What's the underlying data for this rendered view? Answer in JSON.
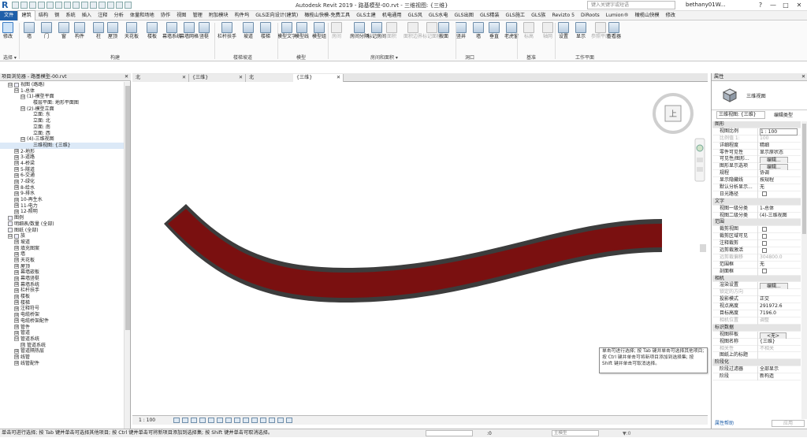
{
  "titlebar": {
    "logo": "R",
    "title": "Autodesk Revit 2019 -   路基模型-00.rvt - 三维视图: {三维}",
    "search_placeholder": "键入关键字或短语",
    "user": "bethany01W...",
    "help": "?",
    "minimize": "—",
    "maximize": "□",
    "close": "✕"
  },
  "menu": {
    "items": [
      "文件",
      "建筑",
      "结构",
      "钢",
      "系统",
      "插入",
      "注释",
      "分析",
      "体量和场地",
      "协作",
      "视图",
      "管理",
      "附加模块",
      "构件坞",
      "GLS正向设计(建筑)",
      "橄榄山快模-免费工具",
      "GLS土建",
      "机电通用",
      "GLS风",
      "GLS水电",
      "GLS出图",
      "GLS精装",
      "GLS施工",
      "GLS族",
      "Revizto 5",
      "DiRoots",
      "Lumion®",
      "橄榄山快模",
      "修改"
    ]
  },
  "ribbon": {
    "tools": [
      "修改",
      "墙",
      "门",
      "窗",
      "构件",
      "柱",
      "屋顶",
      "天花板",
      "楼板",
      "幕墙系统",
      "幕墙网格",
      "竖梃",
      "栏杆扶手",
      "坡道",
      "楼梯",
      "模型文字",
      "模型线",
      "模型组",
      "房间",
      "房间分隔",
      "标记房间",
      "面积",
      "面积边界",
      "标记面积",
      "按面",
      "竖井",
      "墙",
      "垂直",
      "老虎窗",
      "标高",
      "轴网",
      "设置",
      "显示",
      "参照平面",
      "查看器"
    ],
    "panels": [
      "选择 ▾",
      "构建",
      "楼梯坡道",
      "模型",
      "房间和面积 ▾",
      "洞口",
      "基准",
      "工作平面"
    ]
  },
  "project_browser": {
    "title": "项目浏览器 - 路基模型-00.rvt",
    "close": "✕",
    "rows": [
      {
        "label": "视图 (路路)",
        "toggle": "⊟"
      },
      {
        "label": "1-总体",
        "toggle": "⊟"
      },
      {
        "label": "(1)-模型平面",
        "toggle": "⊟"
      },
      {
        "label": "楼层平面: 地形平面图",
        "toggle": ""
      },
      {
        "label": "(2)-模型立面",
        "toggle": "⊟"
      },
      {
        "label": "立面: 东",
        "toggle": ""
      },
      {
        "label": "立面: 北",
        "toggle": ""
      },
      {
        "label": "立面: 南",
        "toggle": ""
      },
      {
        "label": "立面: 西",
        "toggle": ""
      },
      {
        "label": "(4)-三维视图",
        "toggle": "⊟"
      },
      {
        "label": "三维视图: {三维}",
        "toggle": ""
      },
      {
        "label": "2-地形",
        "toggle": "⊞"
      },
      {
        "label": "3-道路",
        "toggle": "⊞"
      },
      {
        "label": "4-桥梁",
        "toggle": "⊞"
      },
      {
        "label": "5-隧道",
        "toggle": "⊞"
      },
      {
        "label": "6-交通",
        "toggle": "⊞"
      },
      {
        "label": "7-绿化",
        "toggle": "⊞"
      },
      {
        "label": "8-给水",
        "toggle": "⊞"
      },
      {
        "label": "9-排水",
        "toggle": "⊞"
      },
      {
        "label": "10-再生水",
        "toggle": "⊞"
      },
      {
        "label": "11-电力",
        "toggle": "⊞"
      },
      {
        "label": "12-照明",
        "toggle": "⊞"
      },
      {
        "label": "图例",
        "toggle": ""
      },
      {
        "label": "明细表/数量 (全部)",
        "toggle": ""
      },
      {
        "label": "图纸 (全部)",
        "toggle": ""
      },
      {
        "label": "族",
        "toggle": "⊟"
      },
      {
        "label": "坡道",
        "toggle": "⊞"
      },
      {
        "label": "填充图案",
        "toggle": "⊞"
      },
      {
        "label": "墙",
        "toggle": "⊞"
      },
      {
        "label": "天花板",
        "toggle": "⊞"
      },
      {
        "label": "屋顶",
        "toggle": "⊞"
      },
      {
        "label": "幕墙嵌板",
        "toggle": "⊞"
      },
      {
        "label": "幕墙竖梃",
        "toggle": "⊞"
      },
      {
        "label": "幕墙系统",
        "toggle": "⊞"
      },
      {
        "label": "栏杆扶手",
        "toggle": "⊞"
      },
      {
        "label": "楼板",
        "toggle": "⊞"
      },
      {
        "label": "楼梯",
        "toggle": "⊞"
      },
      {
        "label": "注释符号",
        "toggle": "⊞"
      },
      {
        "label": "电缆桥架",
        "toggle": "⊞"
      },
      {
        "label": "电缆桥架配件",
        "toggle": "⊞"
      },
      {
        "label": "管件",
        "toggle": "⊞"
      },
      {
        "label": "管道",
        "toggle": "⊞"
      },
      {
        "label": "管道系统",
        "toggle": "⊟"
      },
      {
        "label": "管道系统",
        "toggle": "⊞"
      },
      {
        "label": "管道隔热层",
        "toggle": "⊞"
      },
      {
        "label": "线管",
        "toggle": "⊞"
      },
      {
        "label": "线管配件",
        "toggle": "⊞"
      }
    ]
  },
  "view_tabs": [
    {
      "label": "北",
      "close": "✕"
    },
    {
      "label": "{三维}",
      "close": "✕"
    },
    {
      "label": "北",
      "close": "✕"
    },
    {
      "label": "{三维}",
      "close": "✕"
    }
  ],
  "view_cube": {
    "face": "上"
  },
  "view_bar": {
    "scale": "1 : 100"
  },
  "properties": {
    "title": "属性",
    "close": "✕",
    "type_name": "三维视图",
    "dropdown": "三维视图: {三维}",
    "edit_type": "编辑类型",
    "rows": [
      {
        "k": "图形",
        "v": "",
        "kind": "grp"
      },
      {
        "k": "视图比例",
        "v": "1 : 100",
        "kind": "input"
      },
      {
        "k": "比例值 1:",
        "v": "100",
        "kind": "dim"
      },
      {
        "k": "详细程度",
        "v": "精细",
        "kind": "text"
      },
      {
        "k": "零件可见性",
        "v": "显示原状态",
        "kind": "text"
      },
      {
        "k": "可见性/图形...",
        "v": "编辑...",
        "kind": "btn"
      },
      {
        "k": "图形显示选项",
        "v": "编辑...",
        "kind": "btn"
      },
      {
        "k": "规程",
        "v": "协调",
        "kind": "text"
      },
      {
        "k": "显示隐藏线",
        "v": "按规程",
        "kind": "text"
      },
      {
        "k": "默认分析显示...",
        "v": "无",
        "kind": "text"
      },
      {
        "k": "日光路径",
        "v": "",
        "kind": "check"
      },
      {
        "k": "文字",
        "v": "",
        "kind": "grp"
      },
      {
        "k": "视图一级分类",
        "v": "1-总体",
        "kind": "text"
      },
      {
        "k": "视图二级分类",
        "v": "(4)-三维视图",
        "kind": "text"
      },
      {
        "k": "范围",
        "v": "",
        "kind": "grp"
      },
      {
        "k": "裁剪视图",
        "v": "",
        "kind": "check"
      },
      {
        "k": "裁剪区域可见",
        "v": "",
        "kind": "check"
      },
      {
        "k": "注释裁剪",
        "v": "",
        "kind": "check"
      },
      {
        "k": "远剪裁激活",
        "v": "",
        "kind": "check"
      },
      {
        "k": "远剪裁偏移",
        "v": "304800.0",
        "kind": "dim"
      },
      {
        "k": "范围框",
        "v": "无",
        "kind": "text"
      },
      {
        "k": "剖面框",
        "v": "",
        "kind": "check"
      },
      {
        "k": "相机",
        "v": "",
        "kind": "grp"
      },
      {
        "k": "渲染设置",
        "v": "编辑...",
        "kind": "btn"
      },
      {
        "k": "锁定的方向",
        "v": "",
        "kind": "dim"
      },
      {
        "k": "投影模式",
        "v": "正交",
        "kind": "text"
      },
      {
        "k": "视点高度",
        "v": "291972.6",
        "kind": "text"
      },
      {
        "k": "目标高度",
        "v": "7196.0",
        "kind": "text"
      },
      {
        "k": "相机位置",
        "v": "调整",
        "kind": "dim"
      },
      {
        "k": "标识数据",
        "v": "",
        "kind": "grp"
      },
      {
        "k": "视图样板",
        "v": "<无>",
        "kind": "btn"
      },
      {
        "k": "视图名称",
        "v": "{三维}",
        "kind": "text"
      },
      {
        "k": "相关性",
        "v": "不相关",
        "kind": "dim"
      },
      {
        "k": "图纸上的标题",
        "v": "",
        "kind": "text"
      },
      {
        "k": "阶段化",
        "v": "",
        "kind": "grp"
      },
      {
        "k": "阶段过滤器",
        "v": "全部显示",
        "kind": "text"
      },
      {
        "k": "阶段",
        "v": "新构造",
        "kind": "text"
      }
    ],
    "help": "属性帮助",
    "apply": "应用"
  },
  "tooltip": "单击可进行选择; 按 Tab 键并单击可选择其他项目; 按 Ctrl 键并单击可将新项目添加到选择集; 按 Shift 键并单击可取消选择。",
  "status": {
    "message": "单击可进行选择; 按 Tab 键并单击可选择其他项目; 按 Ctrl 键并单击可将新项目添加到选择集; 按 Shift 键并单击可取消选择。",
    "zero": ":0",
    "model": "主模型",
    "filter_count": "▼:0"
  },
  "colors": {
    "road_fill": "#7a1010",
    "road_edge": "#3c3c3c",
    "accent": "#1f5fa9"
  }
}
